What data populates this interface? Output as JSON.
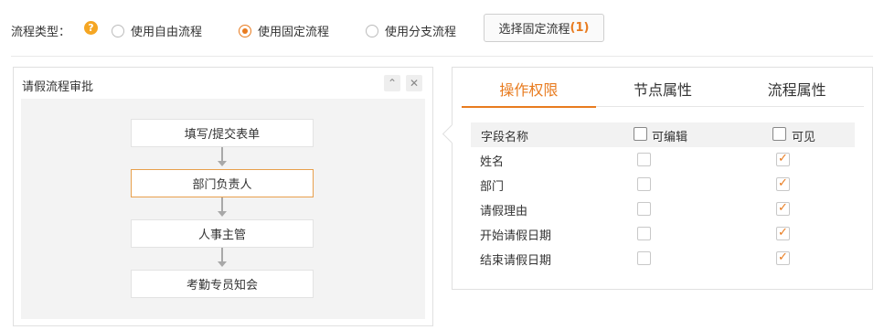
{
  "toolbar": {
    "type_label": "流程类型：",
    "help_glyph": "?",
    "options": [
      {
        "label": "使用自由流程",
        "checked": false
      },
      {
        "label": "使用固定流程",
        "checked": true
      },
      {
        "label": "使用分支流程",
        "checked": false
      }
    ],
    "select_button_text": "选择固定流程",
    "select_button_count": "(1)"
  },
  "left_panel": {
    "title": "请假流程审批",
    "collapse_glyph": "⌃",
    "close_glyph": "✕",
    "nodes": [
      {
        "label": "填写/提交表单",
        "active": false
      },
      {
        "label": "部门负责人",
        "active": true
      },
      {
        "label": "人事主管",
        "active": false
      },
      {
        "label": "考勤专员知会",
        "active": false
      }
    ]
  },
  "right_panel": {
    "tabs": [
      "操作权限",
      "节点属性",
      "流程属性"
    ],
    "active_tab": 0,
    "header": {
      "field": "字段名称",
      "editable": "可编辑",
      "visible": "可见"
    },
    "rows": [
      {
        "name": "姓名",
        "editable": false,
        "visible": true
      },
      {
        "name": "部门",
        "editable": false,
        "visible": true
      },
      {
        "name": "请假理由",
        "editable": false,
        "visible": true
      },
      {
        "name": "开始请假日期",
        "editable": false,
        "visible": true
      },
      {
        "name": "结束请假日期",
        "editable": false,
        "visible": true
      }
    ]
  },
  "colors": {
    "accent": "#e87b1f",
    "help": "#f5a623"
  }
}
